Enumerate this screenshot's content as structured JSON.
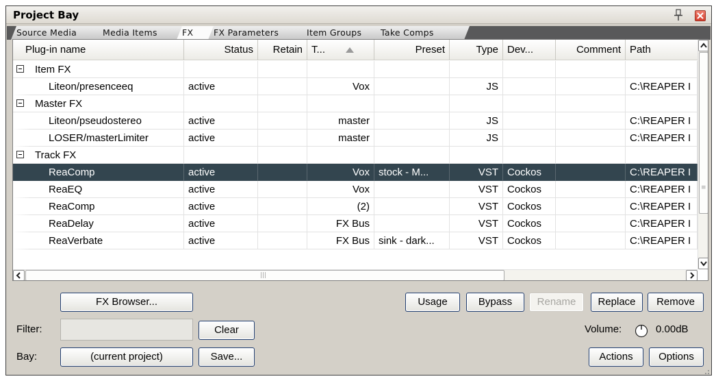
{
  "window": {
    "title": "Project Bay"
  },
  "tabs": [
    {
      "label": "Source Media"
    },
    {
      "label": "Media Items"
    },
    {
      "label": "FX",
      "active": true
    },
    {
      "label": "FX Parameters"
    },
    {
      "label": "Item Groups"
    },
    {
      "label": "Take Comps"
    }
  ],
  "grid": {
    "columns": [
      "Plug-in name",
      "Status",
      "Retain",
      "T...",
      "Preset",
      "Type",
      "Dev...",
      "Comment",
      "Path"
    ],
    "sorted_column": "T...",
    "groups": [
      {
        "label": "Item FX"
      },
      {
        "label": "Master FX"
      },
      {
        "label": "Track FX"
      }
    ],
    "rows": [
      {
        "name": "Liteon/presenceeq",
        "status": "active",
        "retain": "",
        "track": "Vox",
        "preset": "",
        "type": "JS",
        "dev": "",
        "comment": "",
        "path": "C:\\REAPER I"
      },
      {
        "name": "Liteon/pseudostereo",
        "status": "active",
        "retain": "",
        "track": "master",
        "preset": "",
        "type": "JS",
        "dev": "",
        "comment": "",
        "path": "C:\\REAPER I"
      },
      {
        "name": "LOSER/masterLimiter",
        "status": "active",
        "retain": "",
        "track": "master",
        "preset": "",
        "type": "JS",
        "dev": "",
        "comment": "",
        "path": "C:\\REAPER I"
      },
      {
        "name": "ReaComp",
        "status": "active",
        "retain": "",
        "track": "Vox",
        "preset": "stock - M...",
        "type": "VST",
        "dev": "Cockos",
        "comment": "",
        "path": "C:\\REAPER I",
        "selected": true
      },
      {
        "name": "ReaEQ",
        "status": "active",
        "retain": "",
        "track": "Vox",
        "preset": "",
        "type": "VST",
        "dev": "Cockos",
        "comment": "",
        "path": "C:\\REAPER I"
      },
      {
        "name": "ReaComp",
        "status": "active",
        "retain": "",
        "track": "(2)",
        "preset": "",
        "type": "VST",
        "dev": "Cockos",
        "comment": "",
        "path": "C:\\REAPER I"
      },
      {
        "name": "ReaDelay",
        "status": "active",
        "retain": "",
        "track": "FX Bus",
        "preset": "",
        "type": "VST",
        "dev": "Cockos",
        "comment": "",
        "path": "C:\\REAPER I"
      },
      {
        "name": "ReaVerbate",
        "status": "active",
        "retain": "",
        "track": "FX Bus",
        "preset": "sink - dark...",
        "type": "VST",
        "dev": "Cockos",
        "comment": "",
        "path": "C:\\REAPER I"
      }
    ]
  },
  "buttons": {
    "fx_browser": "FX Browser...",
    "usage": "Usage",
    "bypass": "Bypass",
    "rename": "Rename",
    "replace": "Replace",
    "remove": "Remove",
    "clear": "Clear",
    "save": "Save...",
    "actions": "Actions",
    "options": "Options",
    "bay_select": "(current project)"
  },
  "labels": {
    "filter": "Filter:",
    "bay": "Bay:",
    "volume": "Volume:",
    "volume_value": "0.00dB"
  },
  "filter": {
    "value": ""
  },
  "icons": {
    "pin": "pin-icon",
    "close": "close-icon",
    "sort": "sort-ascending-icon",
    "expander": "collapse-box-icon",
    "volume_knob": "knob-icon"
  },
  "colors": {
    "selected_row": "#33454f",
    "tabstrip": "#59595a",
    "close": "#d44030"
  }
}
